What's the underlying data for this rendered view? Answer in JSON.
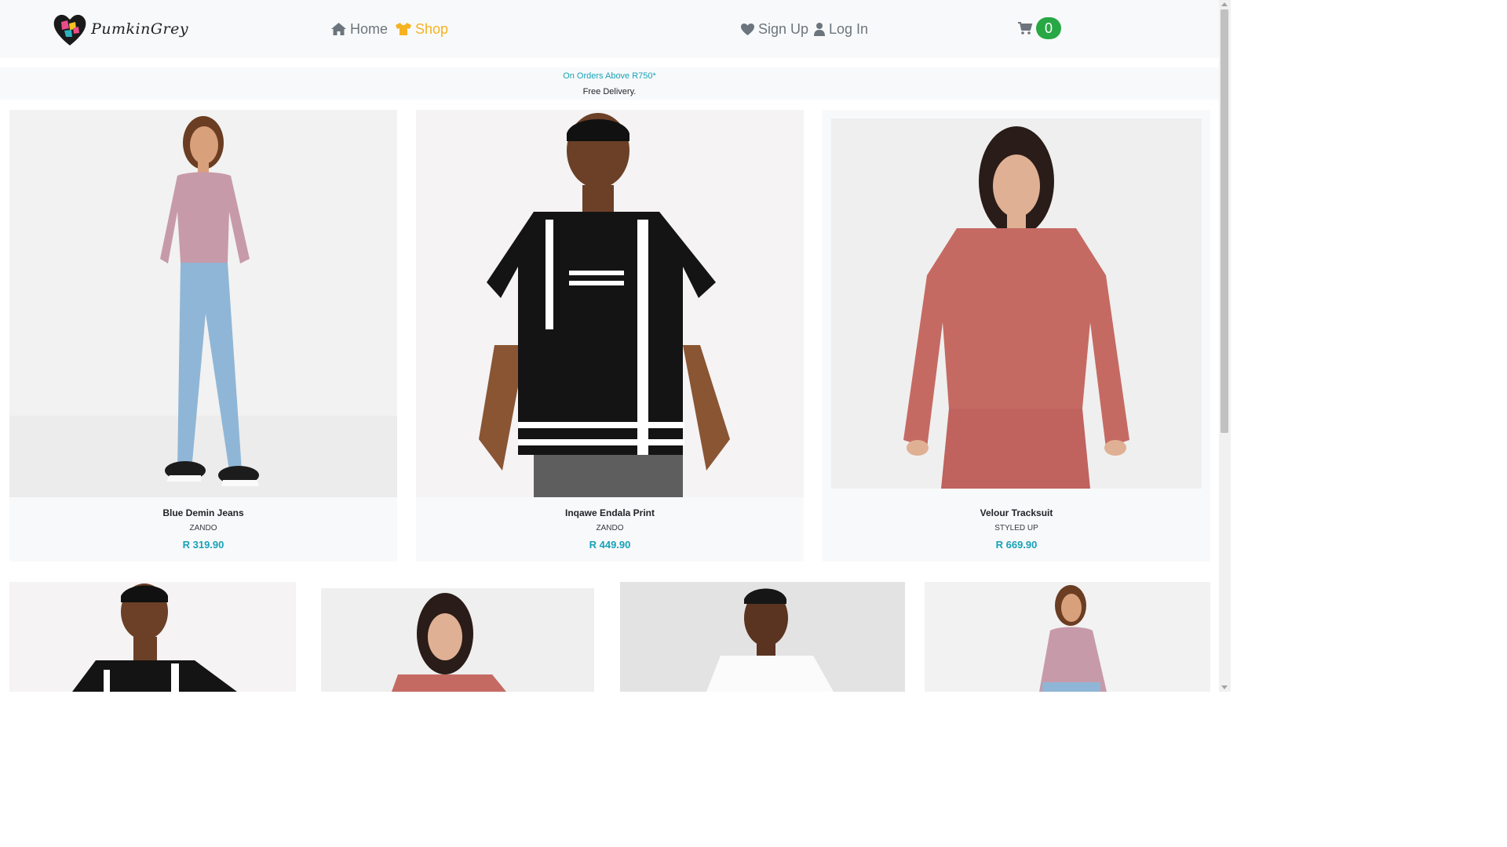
{
  "header": {
    "logo_text": "PumkinGrey",
    "nav": {
      "home": "Home",
      "shop": "Shop",
      "signup": "Sign Up",
      "login": "Log In"
    },
    "cart_count": "0"
  },
  "promo": {
    "line1": "On Orders Above R750*",
    "line2": "Free Delivery."
  },
  "products": [
    {
      "name": "Blue Demin Jeans",
      "brand": "ZANDO",
      "price": "R 319.90"
    },
    {
      "name": "Inqawe Endala Print",
      "brand": "ZANDO",
      "price": "R 449.90"
    },
    {
      "name": "Velour Tracksuit",
      "brand": "STYLED UP",
      "price": "R 669.90"
    }
  ],
  "colors": {
    "active_nav": "#f6b321",
    "accent_price": "#17a2b8",
    "cart_badge": "#28a745",
    "navbar_bg": "#f8f9fa"
  },
  "icons": {
    "home": "home-icon",
    "shop": "tshirt-icon",
    "signup": "heart-icon",
    "login": "user-icon",
    "cart": "shopping-cart-icon"
  }
}
